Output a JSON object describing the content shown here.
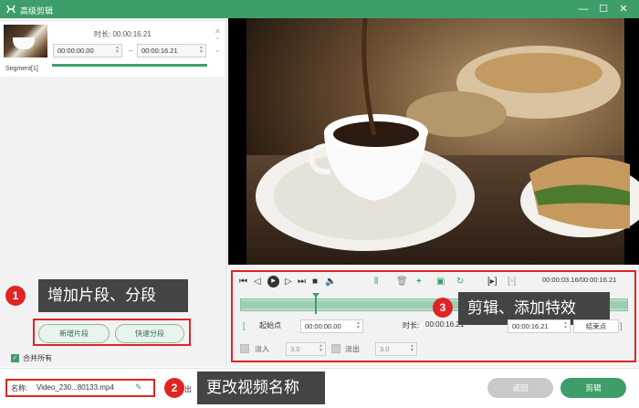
{
  "window": {
    "title": "高级剪辑",
    "minimize": "—",
    "maximize": "☐",
    "close": "✕"
  },
  "segment": {
    "label": "Segment[1]",
    "duration_label": "时长:",
    "duration": "00:00:16.21",
    "start_time": "00:00:00.00",
    "separator": "–",
    "end_time": "00:00:16.21"
  },
  "left_buttons": {
    "add_segment": "新增片段",
    "quick_split": "快速分段"
  },
  "merge_all": "合并所有",
  "callouts": {
    "c1": {
      "num": "1",
      "text": "增加片段、分段"
    },
    "c2": {
      "num": "2",
      "text": "更改视频名称"
    },
    "c3": {
      "num": "3",
      "text": "剪辑、添加特效"
    }
  },
  "playback": {
    "time": "00:00:03.16/00:00:16.21",
    "position_fraction": 0.195
  },
  "trim": {
    "start_label": "起始点",
    "start_bracket": "[",
    "start_time": "00:00:00.00",
    "duration_label": "时长:",
    "duration": "00:00:16.21",
    "end_time": "00:00:16.21",
    "end_button": "结束点",
    "end_bracket": "]"
  },
  "fade": {
    "fade_in_label": "淡入",
    "fade_in_value": "3.0",
    "fade_out_label": "淡出",
    "fade_out_value": "3.0"
  },
  "file": {
    "name_label": "名称:",
    "name": "Video_230...80133.mp4",
    "partial_text": "出"
  },
  "actions": {
    "back": "返回",
    "edit": "剪辑"
  },
  "colors": {
    "accent": "#3e9e6a",
    "callout_badge": "#e02424",
    "callout_bg": "#444444"
  }
}
